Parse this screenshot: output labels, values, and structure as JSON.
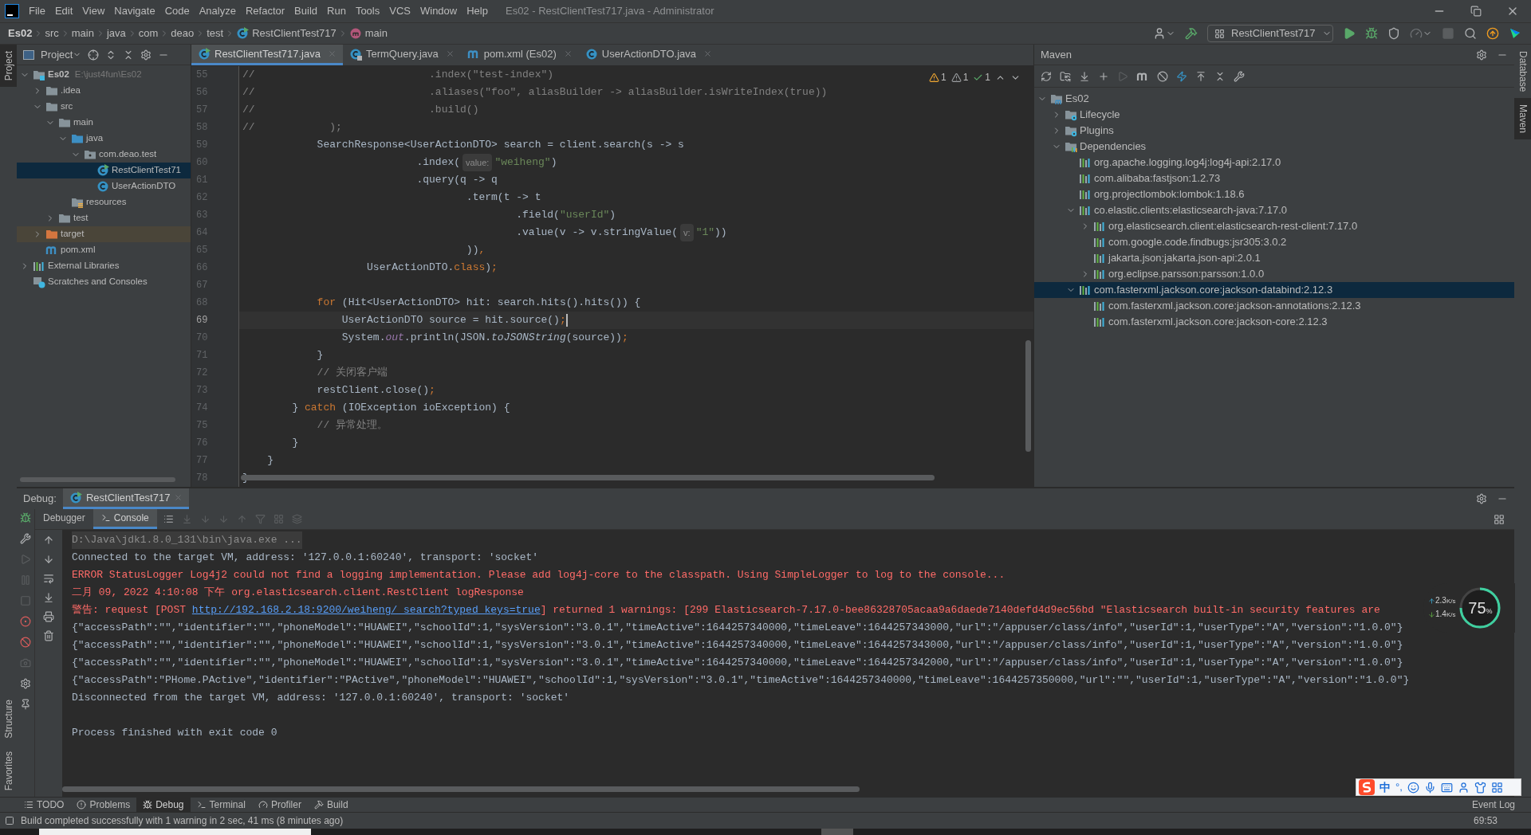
{
  "menu": [
    "File",
    "Edit",
    "View",
    "Navigate",
    "Code",
    "Analyze",
    "Refactor",
    "Build",
    "Run",
    "Tools",
    "VCS",
    "Window",
    "Help"
  ],
  "window": {
    "title": "Es02 - RestClientTest717.java - Administrator"
  },
  "breadcrumbs": [
    {
      "label": "Es02",
      "kind": "project"
    },
    {
      "label": "src",
      "kind": "folder"
    },
    {
      "label": "main",
      "kind": "folder"
    },
    {
      "label": "java",
      "kind": "folder"
    },
    {
      "label": "com",
      "kind": "folder"
    },
    {
      "label": "deao",
      "kind": "folder"
    },
    {
      "label": "test",
      "kind": "folder"
    },
    {
      "label": "RestClientTest717",
      "kind": "class"
    },
    {
      "label": "main",
      "kind": "method"
    }
  ],
  "run_config": "RestClientTest717",
  "left_stripe": [
    {
      "label": "Project",
      "selected": true
    },
    {
      "label": "Structure",
      "selected": false
    },
    {
      "label": "Favorites",
      "selected": false
    }
  ],
  "right_stripe": [
    {
      "label": "Database",
      "selected": false
    },
    {
      "label": "Maven",
      "selected": true
    }
  ],
  "project": {
    "title": "Project",
    "tree": [
      {
        "label": "Es02",
        "path": "E:\\just4fun\\Es02",
        "kind": "module",
        "expanded": true,
        "selected": false,
        "children": [
          {
            "label": ".idea",
            "kind": "folder",
            "expanded": false,
            "selected": false
          },
          {
            "label": "src",
            "kind": "folder",
            "expanded": true,
            "selected": false,
            "children": [
              {
                "label": "main",
                "kind": "folder",
                "expanded": true,
                "selected": false,
                "children": [
                  {
                    "label": "java",
                    "kind": "source",
                    "expanded": true,
                    "selected": false,
                    "children": [
                      {
                        "label": "com.deao.test",
                        "kind": "package",
                        "expanded": true,
                        "selected": false,
                        "children": [
                          {
                            "label": "RestClientTest71",
                            "kind": "runnable",
                            "selected": true
                          },
                          {
                            "label": "UserActionDTO",
                            "kind": "class",
                            "selected": false
                          }
                        ]
                      }
                    ]
                  },
                  {
                    "label": "resources",
                    "kind": "resources",
                    "selected": false
                  }
                ]
              },
              {
                "label": "test",
                "kind": "folder",
                "expanded": false,
                "selected": false
              }
            ]
          },
          {
            "label": "target",
            "kind": "excluded",
            "expanded": false,
            "selected": false
          },
          {
            "label": "pom.xml",
            "kind": "maven",
            "selected": false
          }
        ]
      },
      {
        "label": "External Libraries",
        "kind": "libraries",
        "expanded": false,
        "selected": false
      },
      {
        "label": "Scratches and Consoles",
        "kind": "scratches",
        "selected": false
      }
    ]
  },
  "editor_tabs": [
    {
      "label": "RestClientTest717.java",
      "kind": "runnable",
      "selected": true
    },
    {
      "label": "TermQuery.java",
      "kind": "locked",
      "selected": false
    },
    {
      "label": "pom.xml (Es02)",
      "kind": "maven",
      "selected": false
    },
    {
      "label": "UserActionDTO.java",
      "kind": "class",
      "selected": false
    }
  ],
  "inspections": [
    {
      "count": "1",
      "kind": "warning"
    },
    {
      "count": "1",
      "kind": "weak"
    },
    {
      "count": "1",
      "kind": "typo"
    }
  ],
  "code": [
    {
      "n": "55",
      "current": false,
      "tokens": [
        {
          "kind": "comment",
          "text": "//                            .index(\"test-index\")"
        }
      ]
    },
    {
      "n": "56",
      "current": false,
      "tokens": [
        {
          "kind": "comment",
          "text": "//                            .aliases(\"foo\", aliasBuilder -> aliasBuilder.isWriteIndex(true))"
        }
      ]
    },
    {
      "n": "57",
      "current": false,
      "tokens": [
        {
          "kind": "comment",
          "text": "//                            .build()"
        }
      ]
    },
    {
      "n": "58",
      "current": false,
      "tokens": [
        {
          "kind": "comment",
          "text": "//            );"
        }
      ]
    },
    {
      "n": "59",
      "current": false,
      "tokens": [
        {
          "kind": "plain",
          "text": "            SearchResponse<UserActionDTO> search = client.search(s -> s"
        }
      ]
    },
    {
      "n": "60",
      "current": false,
      "tokens": [
        {
          "kind": "plain",
          "text": "                            .index("
        },
        {
          "kind": "hint",
          "text": "value:"
        },
        {
          "kind": "string",
          "text": "\"weiheng\""
        },
        {
          "kind": "plain",
          "text": ")"
        }
      ]
    },
    {
      "n": "61",
      "current": false,
      "tokens": [
        {
          "kind": "plain",
          "text": "                            .query(q -> q"
        }
      ]
    },
    {
      "n": "62",
      "current": false,
      "tokens": [
        {
          "kind": "plain",
          "text": "                                    .term(t -> t"
        }
      ]
    },
    {
      "n": "63",
      "current": false,
      "tokens": [
        {
          "kind": "plain",
          "text": "                                            .field("
        },
        {
          "kind": "string",
          "text": "\"userId\""
        },
        {
          "kind": "plain",
          "text": ")"
        }
      ]
    },
    {
      "n": "64",
      "current": false,
      "tokens": [
        {
          "kind": "plain",
          "text": "                                            .value(v -> v.stringValue("
        },
        {
          "kind": "hint",
          "text": "v:"
        },
        {
          "kind": "string",
          "text": "\"1\""
        },
        {
          "kind": "plain",
          "text": "))"
        }
      ]
    },
    {
      "n": "65",
      "current": false,
      "tokens": [
        {
          "kind": "plain",
          "text": "                                    ))"
        },
        {
          "kind": "keyword",
          "text": ","
        }
      ]
    },
    {
      "n": "66",
      "current": false,
      "tokens": [
        {
          "kind": "plain",
          "text": "                    UserActionDTO."
        },
        {
          "kind": "keyword",
          "text": "class"
        },
        {
          "kind": "plain",
          "text": ")"
        },
        {
          "kind": "keyword",
          "text": ";"
        }
      ]
    },
    {
      "n": "67",
      "current": false
    },
    {
      "n": "68",
      "current": false,
      "tokens": [
        {
          "kind": "keyword",
          "text": "            for"
        },
        {
          "kind": "plain",
          "text": " (Hit<UserActionDTO> hit: search.hits().hits()) {"
        }
      ]
    },
    {
      "n": "69",
      "current": true,
      "tokens": [
        {
          "kind": "plain",
          "text": "                UserActionDTO source = hit.source()"
        },
        {
          "kind": "keyword",
          "text": ";"
        }
      ]
    },
    {
      "n": "70",
      "current": false,
      "tokens": [
        {
          "kind": "plain",
          "text": "                System."
        },
        {
          "kind": "static",
          "text": "out"
        },
        {
          "kind": "plain",
          "text": ".println(JSON."
        },
        {
          "kind": "italic",
          "text": "toJSONString"
        },
        {
          "kind": "plain",
          "text": "(source))"
        },
        {
          "kind": "keyword",
          "text": ";"
        }
      ]
    },
    {
      "n": "71",
      "current": false,
      "tokens": [
        {
          "kind": "plain",
          "text": "            }"
        }
      ]
    },
    {
      "n": "72",
      "current": false,
      "tokens": [
        {
          "kind": "comment",
          "text": "            // 关闭客户端"
        }
      ]
    },
    {
      "n": "73",
      "current": false,
      "tokens": [
        {
          "kind": "plain",
          "text": "            restClient.close()"
        },
        {
          "kind": "keyword",
          "text": ";"
        }
      ]
    },
    {
      "n": "74",
      "current": false,
      "tokens": [
        {
          "kind": "plain",
          "text": "        } "
        },
        {
          "kind": "keyword",
          "text": "catch"
        },
        {
          "kind": "plain",
          "text": " (IOException ioException) {"
        }
      ]
    },
    {
      "n": "75",
      "current": false,
      "tokens": [
        {
          "kind": "comment",
          "text": "            // 异常处理。"
        }
      ]
    },
    {
      "n": "76",
      "current": false,
      "tokens": [
        {
          "kind": "plain",
          "text": "        }"
        }
      ]
    },
    {
      "n": "77",
      "current": false,
      "tokens": [
        {
          "kind": "plain",
          "text": "    }"
        }
      ]
    },
    {
      "n": "78",
      "current": false,
      "tokens": [
        {
          "kind": "plain",
          "text": "}"
        }
      ]
    }
  ],
  "maven": {
    "title": "Maven",
    "tree": [
      {
        "label": "Es02",
        "kind": "maven-module",
        "expanded": true,
        "selected": false,
        "children": [
          {
            "label": "Lifecycle",
            "kind": "gear-folder",
            "expanded": false,
            "selected": false
          },
          {
            "label": "Plugins",
            "kind": "gear-folder",
            "expanded": false,
            "selected": false
          },
          {
            "label": "Dependencies",
            "kind": "deps-folder",
            "expanded": true,
            "selected": false,
            "children": [
              {
                "label": "org.apache.logging.log4j:log4j-api:2.17.0",
                "kind": "library",
                "selected": false
              },
              {
                "label": "com.alibaba:fastjson:1.2.73",
                "kind": "library",
                "selected": false
              },
              {
                "label": "org.projectlombok:lombok:1.18.6",
                "kind": "library",
                "selected": false
              },
              {
                "label": "co.elastic.clients:elasticsearch-java:7.17.0",
                "kind": "library",
                "expanded": true,
                "selected": false,
                "children": [
                  {
                    "label": "org.elasticsearch.client:elasticsearch-rest-client:7.17.0",
                    "kind": "library",
                    "expanded": false,
                    "selected": false
                  },
                  {
                    "label": "com.google.code.findbugs:jsr305:3.0.2",
                    "kind": "library",
                    "selected": false
                  },
                  {
                    "label": "jakarta.json:jakarta.json-api:2.0.1",
                    "kind": "library",
                    "selected": false
                  },
                  {
                    "label": "org.eclipse.parsson:parsson:1.0.0",
                    "kind": "library",
                    "expanded": false,
                    "selected": false
                  }
                ]
              },
              {
                "label": "com.fasterxml.jackson.core:jackson-databind:2.12.3",
                "kind": "library",
                "expanded": true,
                "selected": true,
                "children": [
                  {
                    "label": "com.fasterxml.jackson.core:jackson-annotations:2.12.3",
                    "kind": "library",
                    "selected": false
                  },
                  {
                    "label": "com.fasterxml.jackson.core:jackson-core:2.12.3",
                    "kind": "library",
                    "selected": false
                  }
                ]
              }
            ]
          }
        ]
      }
    ]
  },
  "debug": {
    "label": "Debug:",
    "session": "RestClientTest717",
    "tabs": [
      {
        "label": "Debugger",
        "selected": false
      },
      {
        "label": "Console",
        "selected": true
      }
    ]
  },
  "console": [
    {
      "segs": [
        {
          "kind": "gray",
          "text": "D:\\Java\\jdk1.8.0_131\\bin\\java.exe ..."
        }
      ]
    },
    {
      "segs": [
        {
          "kind": "plain",
          "text": "Connected to the target VM, address: '127.0.0.1:60240', transport: 'socket'"
        }
      ]
    },
    {
      "segs": [
        {
          "kind": "error",
          "text": "ERROR StatusLogger Log4j2 could not find a logging implementation. Please add log4j-core to the classpath. Using SimpleLogger to log to the console..."
        }
      ]
    },
    {
      "segs": [
        {
          "kind": "error",
          "text": "二月 09, 2022 4:10:08 下午 org.elasticsearch.client.RestClient logResponse"
        }
      ]
    },
    {
      "segs": [
        {
          "kind": "error",
          "text": "警告: request [POST "
        },
        {
          "kind": "link",
          "text": "http://192.168.2.18:9200/weiheng/_search?typed_keys=true"
        },
        {
          "kind": "error",
          "text": "] returned 1 warnings: [299 Elasticsearch-7.17.0-bee86328705acaa9a6daede7140defd4d9ec56bd \"Elasticsearch built-in security features are"
        }
      ]
    },
    {
      "segs": [
        {
          "kind": "plain",
          "text": "{\"accessPath\":\"\",\"identifier\":\"\",\"phoneModel\":\"HUAWEI\",\"schoolId\":1,\"sysVersion\":\"3.0.1\",\"timeActive\":1644257340000,\"timeLeave\":1644257343000,\"url\":\"/appuser/class/info\",\"userId\":1,\"userType\":\"A\",\"version\":\"1.0.0\"}"
        }
      ]
    },
    {
      "segs": [
        {
          "kind": "plain",
          "text": "{\"accessPath\":\"\",\"identifier\":\"\",\"phoneModel\":\"HUAWEI\",\"schoolId\":1,\"sysVersion\":\"3.0.1\",\"timeActive\":1644257340000,\"timeLeave\":1644257343000,\"url\":\"/appuser/class/info\",\"userId\":1,\"userType\":\"A\",\"version\":\"1.0.0\"}"
        }
      ]
    },
    {
      "segs": [
        {
          "kind": "plain",
          "text": "{\"accessPath\":\"\",\"identifier\":\"\",\"phoneModel\":\"HUAWEI\",\"schoolId\":1,\"sysVersion\":\"3.0.1\",\"timeActive\":1644257340000,\"timeLeave\":1644257342000,\"url\":\"/appuser/class/info\",\"userId\":1,\"userType\":\"A\",\"version\":\"1.0.0\"}"
        }
      ]
    },
    {
      "segs": [
        {
          "kind": "plain",
          "text": "{\"accessPath\":\"PHome.PActive\",\"identifier\":\"PActive\",\"phoneModel\":\"HUAWEI\",\"schoolId\":1,\"sysVersion\":\"3.0.1\",\"timeActive\":1644257340000,\"timeLeave\":1644257350000,\"url\":\"\",\"userId\":1,\"userType\":\"A\",\"version\":\"1.0.0\"}"
        }
      ]
    },
    {
      "segs": [
        {
          "kind": "plain",
          "text": "Disconnected from the target VM, address: '127.0.0.1:60240', transport: 'socket'"
        }
      ]
    },
    {
      "segs": [
        {
          "kind": "plain",
          "text": "Process finished with exit code 0"
        }
      ]
    }
  ],
  "bottom_tabs": [
    {
      "label": "TODO",
      "selected": false
    },
    {
      "label": "Problems",
      "selected": false
    },
    {
      "label": "Debug",
      "selected": true
    },
    {
      "label": "Terminal",
      "selected": false
    },
    {
      "label": "Profiler",
      "selected": false
    },
    {
      "label": "Build",
      "selected": false
    }
  ],
  "status": {
    "message": "Build completed successfully with 1 warning in 2 sec, 41 ms (8 minutes ago)",
    "position": "69:53",
    "event_log": "Event Log"
  },
  "net_widget": {
    "up": "2.3",
    "up_unit": "K/s",
    "down": "1.4",
    "down_unit": "K/s",
    "percent": "75",
    "percent_sign": "%"
  },
  "ime": {
    "lang": "中",
    "punct": "°,"
  }
}
